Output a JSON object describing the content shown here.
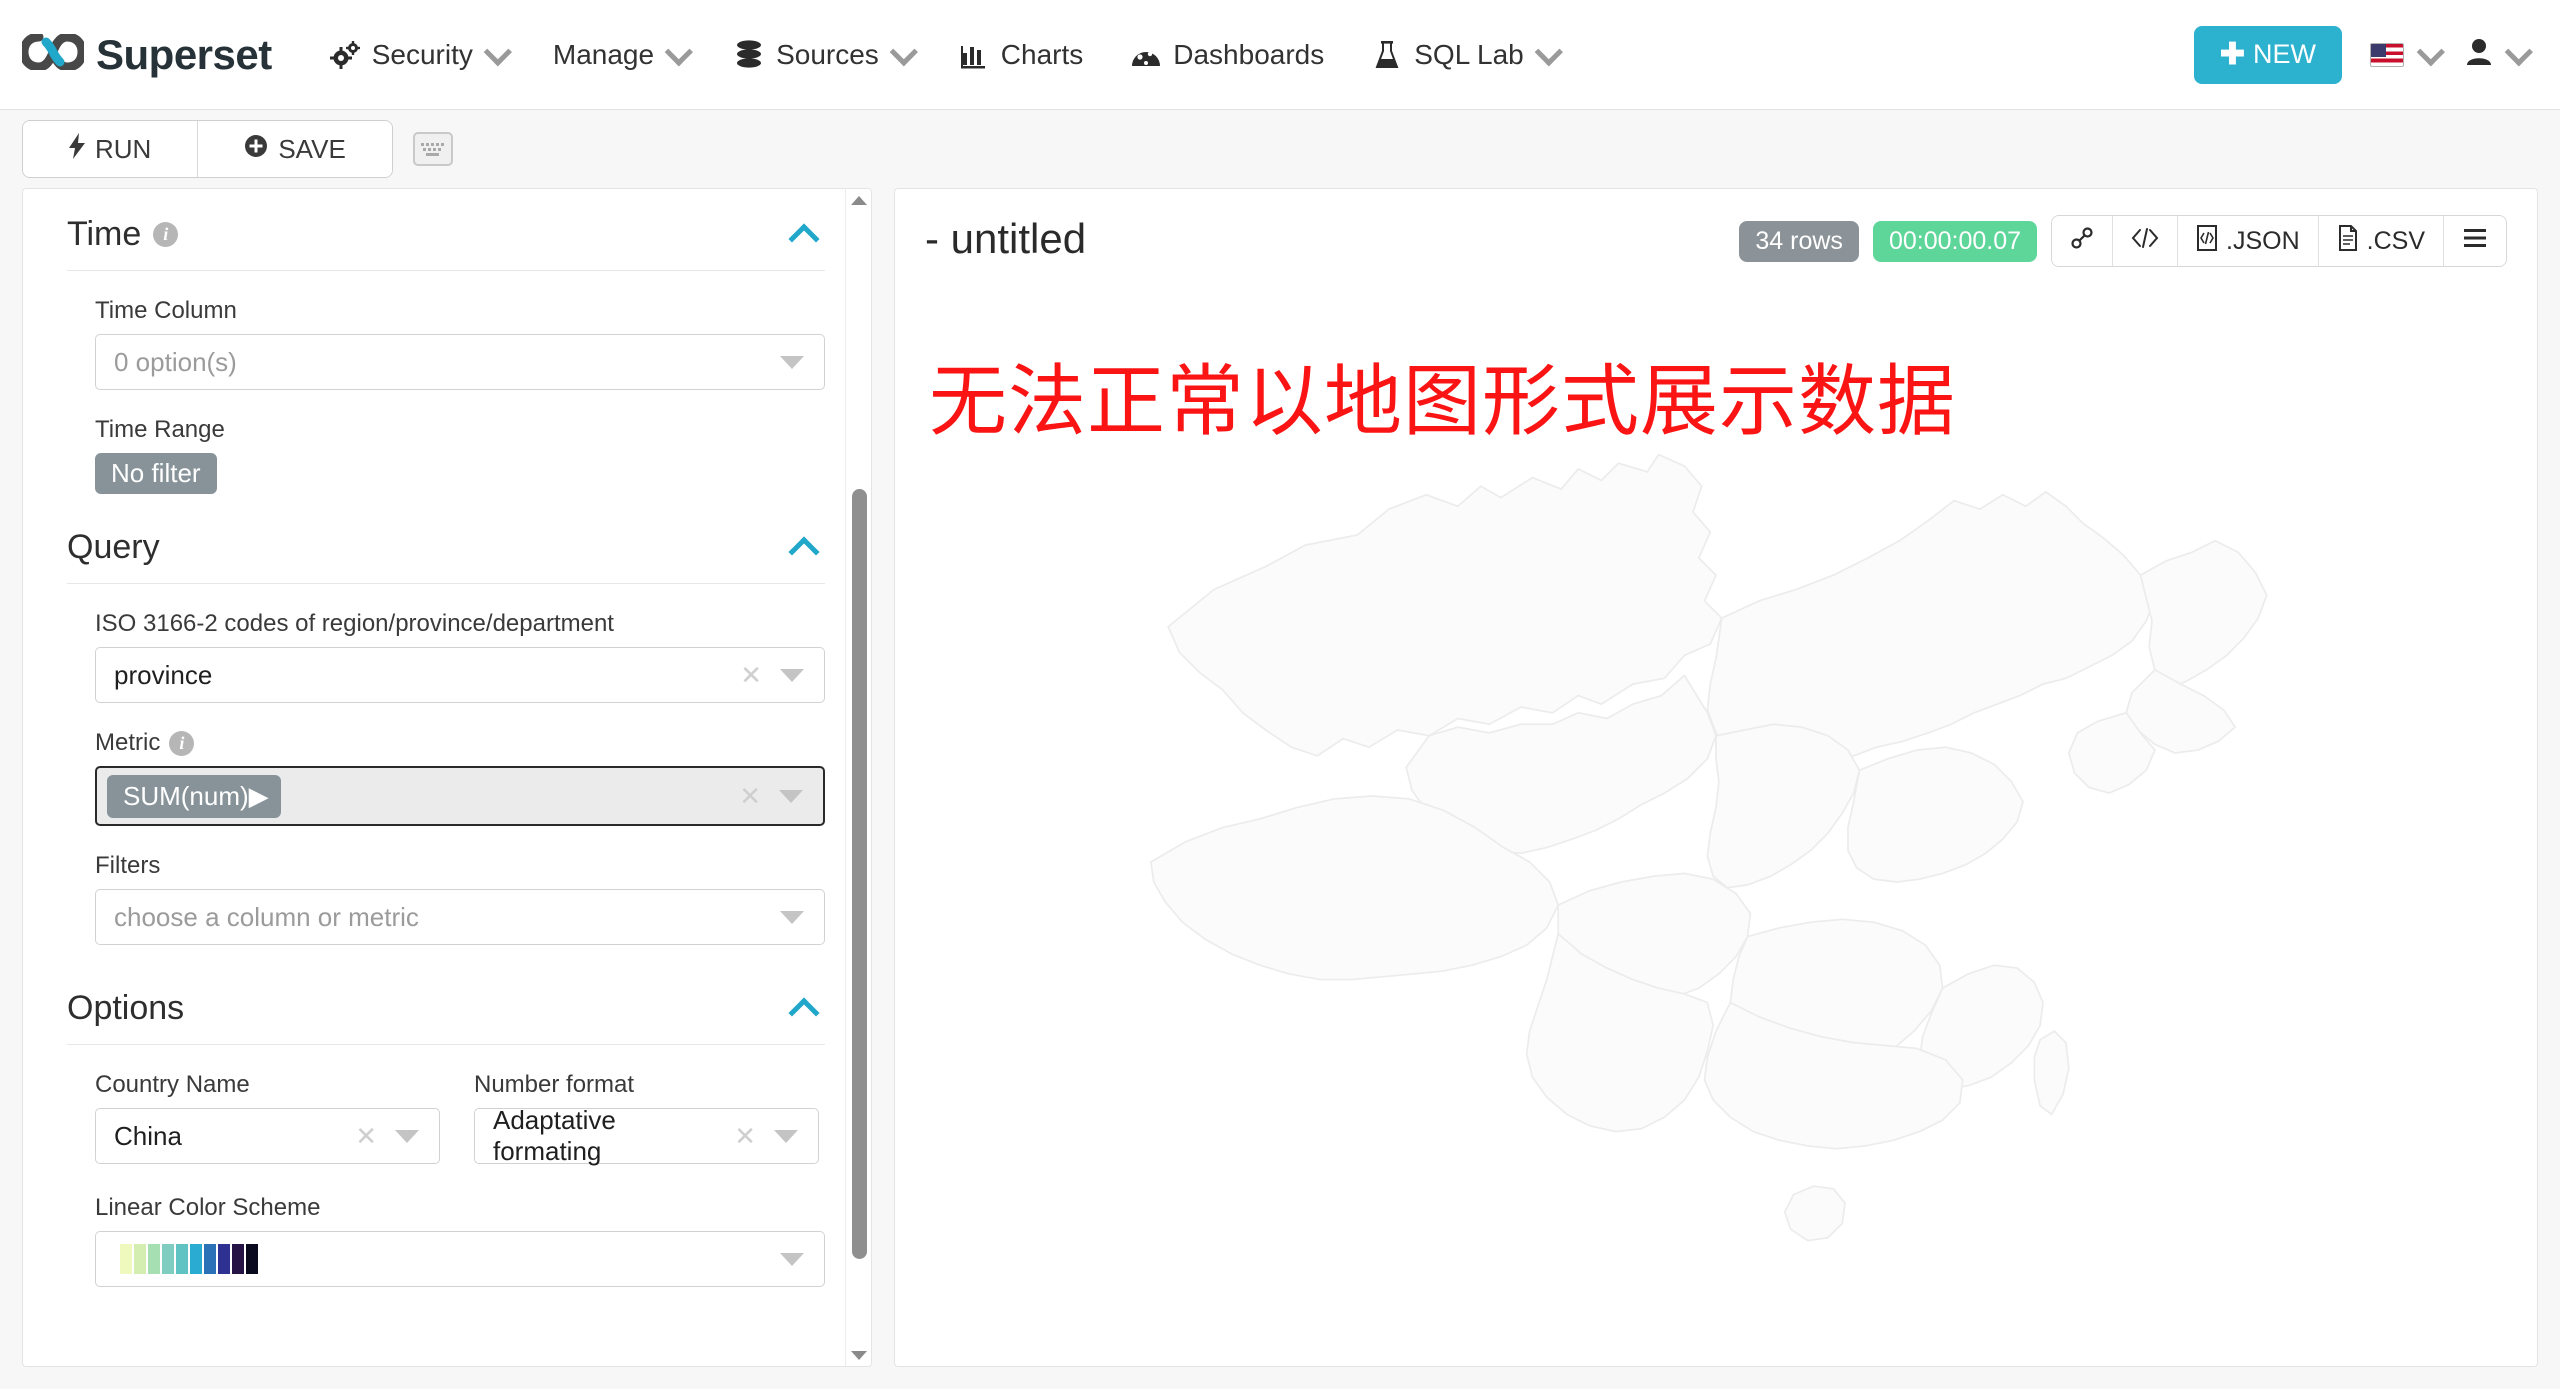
{
  "navbar": {
    "brand": "Superset",
    "brand_icon": "infinity-logo-icon",
    "items": [
      {
        "label": "Security",
        "icon": "gears-icon",
        "has_caret": true
      },
      {
        "label": "Manage",
        "icon": "",
        "has_caret": true
      },
      {
        "label": "Sources",
        "icon": "database-icon",
        "has_caret": true
      },
      {
        "label": "Charts",
        "icon": "bar-chart-icon",
        "has_caret": false
      },
      {
        "label": "Dashboards",
        "icon": "dashboard-gauge-icon",
        "has_caret": false
      },
      {
        "label": "SQL Lab",
        "icon": "flask-icon",
        "has_caret": true
      }
    ],
    "new_button": "NEW",
    "new_button_color": "#2cb1ce",
    "language_icon": "us-flag-icon",
    "user_icon": "user-icon"
  },
  "actionbar": {
    "run_label": "RUN",
    "run_icon": "bolt-icon",
    "save_label": "SAVE",
    "save_icon": "plus-circle-icon",
    "keyboard_icon": "keyboard-icon"
  },
  "control_panel": {
    "sections": [
      {
        "title": "Time",
        "has_info": true,
        "collapse_icon": "chevron-up-icon"
      },
      {
        "title": "Query",
        "has_info": false,
        "collapse_icon": "chevron-up-icon"
      },
      {
        "title": "Options",
        "has_info": false,
        "collapse_icon": "chevron-up-icon"
      }
    ],
    "time_column": {
      "label": "Time Column",
      "value": "",
      "placeholder": "0 option(s)"
    },
    "time_range": {
      "label": "Time Range",
      "value": "No filter"
    },
    "iso_codes": {
      "label": "ISO 3166-2 codes of region/province/department",
      "value": "province"
    },
    "metric": {
      "label": "Metric",
      "has_info": true,
      "value": "SUM(num)",
      "value_suffix": "▶"
    },
    "filters": {
      "label": "Filters",
      "value": "",
      "placeholder": "choose a column or metric"
    },
    "country_name": {
      "label": "Country Name",
      "value": "China"
    },
    "number_format": {
      "label": "Number format",
      "value": "Adaptative formating"
    },
    "linear_color_scheme": {
      "label": "Linear Color Scheme",
      "swatches": [
        "#eff9bd",
        "#d3eeb0",
        "#a6dfb1",
        "#7ecdc0",
        "#5fc3c4",
        "#29abd2",
        "#2a71b7",
        "#2f3192",
        "#261447",
        "#0a0a1e"
      ]
    }
  },
  "chart_panel": {
    "title": "- untitled",
    "rows_badge": "34 rows",
    "time_badge": "00:00:00.07",
    "rows_badge_color": "#8b9398",
    "time_badge_color": "#5ed69a",
    "actions": [
      {
        "label": "",
        "icon": "link-icon"
      },
      {
        "label": "",
        "icon": "code-icon"
      },
      {
        "label": ".JSON",
        "icon": "json-file-icon"
      },
      {
        "label": ".CSV",
        "icon": "csv-file-icon"
      },
      {
        "label": "",
        "icon": "hamburger-menu-icon"
      }
    ],
    "error_overlay_text": "无法正常以地图形式展示数据",
    "error_overlay_color": "#fa1414",
    "map_name": "china-country-map",
    "map_fill": "#fbfbfb",
    "map_stroke": "#ececec"
  }
}
